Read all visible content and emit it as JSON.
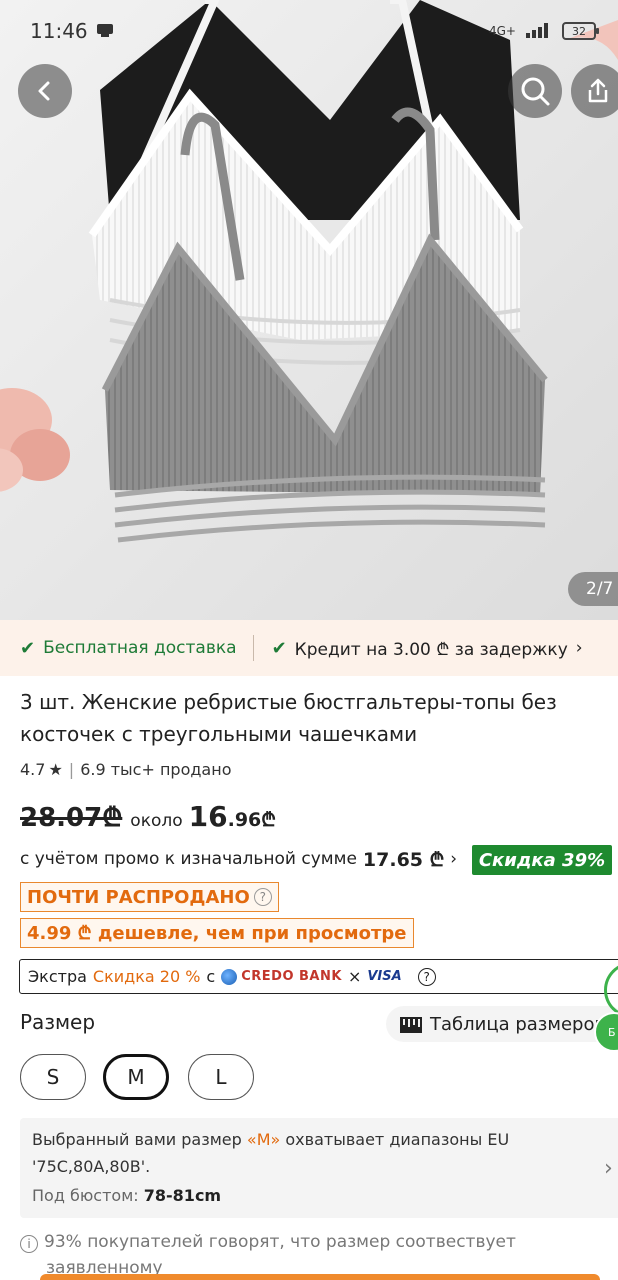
{
  "status_bar": {
    "time": "11:46",
    "network": "4G+",
    "battery": "32"
  },
  "gallery": {
    "counter": "2/7"
  },
  "shipping": {
    "free_delivery": "Бесплатная доставка",
    "credit": "Кредит на 3.00 ₾ за задержку"
  },
  "product": {
    "title": "3 шт. Женские ребристые бюстгальтеры-топы без косточек с треугольными чашечками",
    "rating": "4.7",
    "sold": "6.9 тыс+ продано",
    "old_price": "28.07₾",
    "about_label": "около",
    "new_price_main": "16",
    "new_price_cents": ".96₾",
    "promo_text": "с учётом промо к изначальной сумме",
    "promo_amount": "17.65 ₾",
    "discount": "Скидка 39%",
    "almost_sold_out": "ПОЧТИ РАСПРОДАНО",
    "cheaper": "4.99 ₾ дешевле, чем при просмотре"
  },
  "extra_offer": {
    "prefix": "Экстра",
    "discount": "Скидка 20 %",
    "with": "с",
    "bank": "CREDO BANK",
    "times": "×",
    "card": "VISA"
  },
  "size": {
    "label": "Размер",
    "chart_label": "Таблица размеров",
    "options": [
      "S",
      "M",
      "L"
    ],
    "selected": "M",
    "fit_text_1": "Выбранный вами размер",
    "fit_size": "«M»",
    "fit_text_2": "охватывает диапазоны EU '75C,80A,80B'.",
    "bust_label": "Под бюстом:",
    "bust_value": "78-81cm",
    "note_1": "93% покупателей говорят, что размер соотвествует",
    "note_2": "заявленному"
  },
  "floating": {
    "badge": "Б"
  }
}
